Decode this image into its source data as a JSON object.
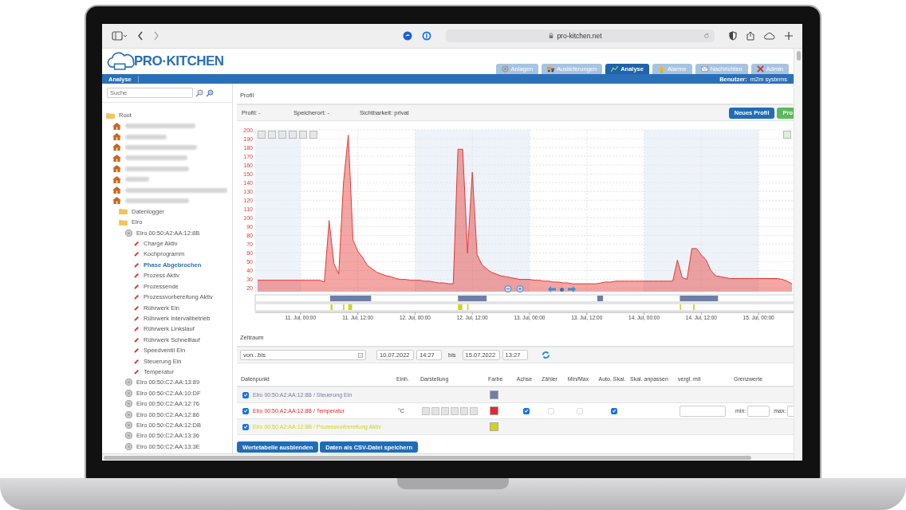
{
  "browser": {
    "url": "pro-kitchen.net"
  },
  "header": {
    "logo": "PRO·KITCHEN",
    "tabs": [
      {
        "label": "Anlagen",
        "selected": false
      },
      {
        "label": "Auslieferungen",
        "selected": false
      },
      {
        "label": "Analyse",
        "selected": true
      },
      {
        "label": "Alarme",
        "selected": false
      },
      {
        "label": "Nachrichten",
        "selected": false
      },
      {
        "label": "Admin",
        "selected": false
      }
    ]
  },
  "navbar": {
    "title": "Analyse",
    "user_label": "Benutzer:",
    "user": "m2m systems"
  },
  "sidebar": {
    "search": {
      "placeholder": "Suche"
    },
    "tree": [
      {
        "kind": "folder",
        "label": "Root",
        "selected": false,
        "children": [
          {
            "kind": "house",
            "blurred": true,
            "selected": false
          },
          {
            "kind": "house",
            "blurred": true,
            "selected": false
          },
          {
            "kind": "house",
            "blurred": true,
            "selected": false
          },
          {
            "kind": "house",
            "blurred": true,
            "selected": false
          },
          {
            "kind": "house",
            "blurred": true,
            "selected": false
          },
          {
            "kind": "house",
            "blurred": true,
            "selected": false
          },
          {
            "kind": "house",
            "blurred": true,
            "selected": false
          },
          {
            "kind": "house",
            "blurred": true,
            "selected": false,
            "children": [
              {
                "kind": "folder",
                "label": "Datenlogger",
                "selected": false
              },
              {
                "kind": "folder",
                "label": "Elro",
                "selected": false,
                "children": [
                  {
                    "kind": "device",
                    "label": "Elro 00:50:A2:AA:12:8B",
                    "selected": false,
                    "children": [
                      {
                        "kind": "point",
                        "label": "Charge Aktiv",
                        "selected": false
                      },
                      {
                        "kind": "point",
                        "label": "Kochprogramm",
                        "selected": false
                      },
                      {
                        "kind": "point",
                        "label": "Phase Abgebrochen",
                        "selected": true
                      },
                      {
                        "kind": "point",
                        "label": "Prozess Aktiv",
                        "selected": false
                      },
                      {
                        "kind": "point",
                        "label": "Prozessende",
                        "selected": false
                      },
                      {
                        "kind": "point",
                        "label": "Prozessvorbereitung Aktiv",
                        "selected": false
                      },
                      {
                        "kind": "point",
                        "label": "Rührwerk Ein",
                        "selected": false
                      },
                      {
                        "kind": "point",
                        "label": "Rührwerk Intervallbetrieb",
                        "selected": false
                      },
                      {
                        "kind": "point",
                        "label": "Rührwerk Linkslauf",
                        "selected": false
                      },
                      {
                        "kind": "point",
                        "label": "Rührwerk Schnelllauf",
                        "selected": false
                      },
                      {
                        "kind": "point",
                        "label": "Speedventil Ein",
                        "selected": false
                      },
                      {
                        "kind": "point",
                        "label": "Steuerung Ein",
                        "selected": false
                      },
                      {
                        "kind": "point",
                        "label": "Temperatur",
                        "selected": false
                      }
                    ]
                  },
                  {
                    "kind": "device",
                    "label": "Elro 00:50:C2-AA:13:89",
                    "selected": false
                  },
                  {
                    "kind": "device",
                    "label": "Elro 00:50:C2:AA:10:DF",
                    "selected": false
                  },
                  {
                    "kind": "device",
                    "label": "Elro 00:50:C2:AA:12:76",
                    "selected": false
                  },
                  {
                    "kind": "device",
                    "label": "Elro 00:50:C2:AA:12:86",
                    "selected": false
                  },
                  {
                    "kind": "device",
                    "label": "Elro 00:50:C2:AA:12:DB",
                    "selected": false
                  },
                  {
                    "kind": "device",
                    "label": "Elro 00:50:C2:AA:13:36",
                    "selected": false
                  },
                  {
                    "kind": "device",
                    "label": "Elro 00:50:C2:AA:13:3E",
                    "selected": false
                  }
                ]
              }
            ]
          }
        ]
      }
    ]
  },
  "profile": {
    "title": "Profil",
    "fields": [
      "Profil: -",
      "Speicherort: -",
      "Sichtbarkeit: privat"
    ],
    "buttons": [
      {
        "label": "Neues Profil",
        "kind": "primary"
      },
      {
        "label": "Pro",
        "kind": "success"
      }
    ],
    "chart_data": {
      "type": "area",
      "categories": [
        null,
        null,
        null,
        null,
        null,
        null,
        null,
        null,
        null,
        "11. Jul, 00:00",
        null,
        null,
        null,
        null,
        null,
        null,
        null,
        null,
        null,
        null,
        null,
        "11. Jul, 12:00",
        null,
        null,
        null,
        null,
        null,
        null,
        null,
        null,
        null,
        null,
        null,
        "12. Jul, 00:00",
        null,
        null,
        null,
        null,
        null,
        null,
        null,
        null,
        null,
        null,
        null,
        "12. Jul, 12:00",
        null,
        null,
        null,
        null,
        null,
        null,
        null,
        null,
        null,
        null,
        null,
        "13. Jul, 00:00",
        null,
        null,
        null,
        null,
        null,
        null,
        null,
        null,
        null,
        null,
        null,
        "13. Jul, 12:00",
        null,
        null,
        null,
        null,
        null,
        null,
        null,
        null,
        null,
        null,
        null,
        "14. Jul, 00:00",
        null,
        null,
        null,
        null,
        null,
        null,
        null,
        null,
        null,
        null,
        null,
        "14. Jul, 12:00",
        null,
        null,
        null,
        null,
        null,
        null,
        null,
        null,
        null,
        null,
        null,
        "15. Jul, 00:00",
        null,
        null,
        null,
        null,
        null,
        null,
        null
      ],
      "series": [
        {
          "color": "#e53935",
          "values": [
            29,
            29,
            29,
            29,
            29,
            29,
            29,
            29,
            29,
            29,
            29,
            29,
            29,
            29,
            27,
            97,
            48,
            36,
            140,
            194,
            75,
            62,
            55,
            46,
            42,
            38,
            36,
            34,
            33,
            31,
            30,
            30,
            29,
            29,
            29,
            28,
            28,
            27,
            26,
            26,
            25,
            25,
            178,
            178,
            60,
            152,
            58,
            47,
            42,
            38,
            36,
            34,
            33,
            32,
            31,
            30,
            30,
            30,
            29,
            29,
            28,
            28,
            27,
            27,
            26,
            26,
            25,
            25,
            25,
            25,
            25,
            25,
            26,
            27,
            27,
            28,
            28,
            28,
            28,
            28,
            28,
            28,
            28,
            28,
            28,
            28,
            28,
            28,
            52,
            32,
            30,
            65,
            65,
            58,
            52,
            40,
            34,
            33,
            32,
            31,
            31,
            31,
            31,
            31,
            31,
            31,
            31,
            31,
            31,
            31,
            30,
            28,
            25
          ]
        }
      ],
      "ylim": [
        16,
        200
      ],
      "grid": true,
      "yticks": [
        20,
        30,
        40,
        50,
        60,
        70,
        80,
        90,
        100,
        110,
        120,
        130,
        140,
        150,
        160,
        170,
        180,
        190,
        200
      ]
    }
  },
  "period": {
    "title": "Zeitraum",
    "mode": "von...bis",
    "from_date": "10.07.2022",
    "from_time": "14:27",
    "between": "bis",
    "to_date": "15.07.2022",
    "to_time": "13:27"
  },
  "table": {
    "columns": [
      "Datenpunkt",
      "Einh.",
      "Darstellung",
      "Farbe",
      "Achse",
      "Zähler",
      "Min/Max",
      "Auto. Skal.",
      "Skal. anpassen",
      "vergl. mit",
      "Grenzwerte"
    ],
    "rows": [
      {
        "kind": "digital",
        "checked": true,
        "name": "Elro 00:50:A2:AA:12:8B / Steuerung Ein",
        "color": "#6f7ea7"
      },
      {
        "kind": "analog",
        "checked": true,
        "name": "Elro 00:50:A2:AA:12:8B / Temperatur",
        "color": "#e8262b",
        "unit": "°C",
        "axis": true,
        "counter": false,
        "minmax": false,
        "auto_scale": true,
        "min_label": "min:",
        "max_label": "max:"
      },
      {
        "kind": "digital",
        "checked": true,
        "name": "Elro 00:50:A2:AA:12:8B / Prozessvorbereitung Aktiv",
        "color": "#d2d218"
      }
    ]
  },
  "buttons": [
    "Wertetabelle ausblenden",
    "Daten als CSV-Datei speichern"
  ]
}
